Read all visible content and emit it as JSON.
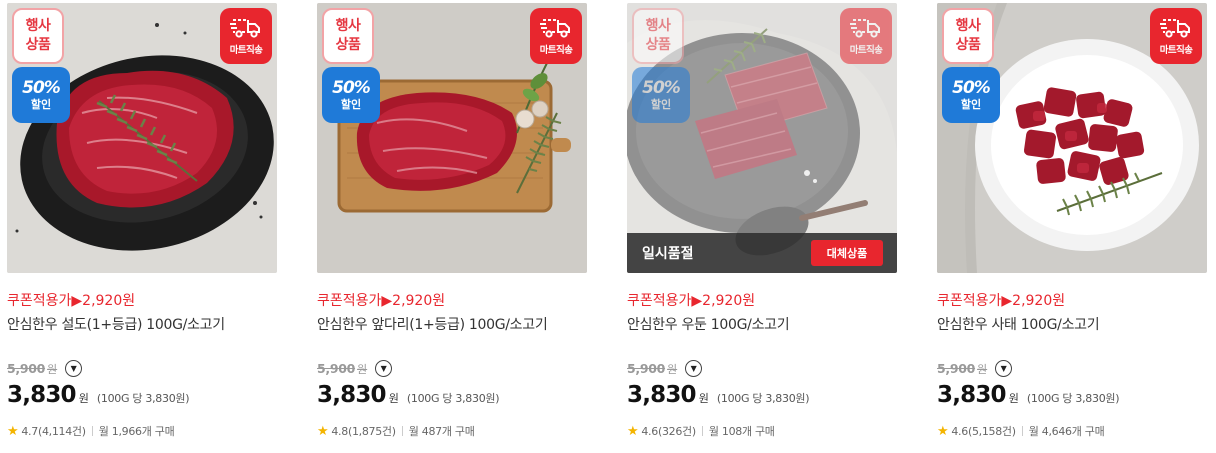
{
  "badges": {
    "event_line1": "행사",
    "event_line2": "상품",
    "mart_delivery": "마트직송",
    "sale_percent": "50%",
    "sale_label": "할인"
  },
  "soldout": {
    "text": "일시품절",
    "button": "대체상품"
  },
  "colors": {
    "accent_red": "#e8262e",
    "sale_blue": "#1f7ad8",
    "star": "#f4b400"
  },
  "products": [
    {
      "coupon": "쿠폰적용가▶2,920원",
      "title": "안심한우 설도(1+등급) 100G/소고기",
      "original_price": "5,900",
      "original_won": "원",
      "price": "3,830",
      "won": "원",
      "unit_price": "(100G 당 3,830원)",
      "rating": "4.7(4,114건)",
      "monthly": "월 1,966개 구매",
      "soldout": false
    },
    {
      "coupon": "쿠폰적용가▶2,920원",
      "title": "안심한우 앞다리(1+등급) 100G/소고기",
      "original_price": "5,900",
      "original_won": "원",
      "price": "3,830",
      "won": "원",
      "unit_price": "(100G 당 3,830원)",
      "rating": "4.8(1,875건)",
      "monthly": "월 487개 구매",
      "soldout": false
    },
    {
      "coupon": "쿠폰적용가▶2,920원",
      "title": "안심한우 우둔 100G/소고기",
      "original_price": "5,900",
      "original_won": "원",
      "price": "3,830",
      "won": "원",
      "unit_price": "(100G 당 3,830원)",
      "rating": "4.6(326건)",
      "monthly": "월 108개 구매",
      "soldout": true
    },
    {
      "coupon": "쿠폰적용가▶2,920원",
      "title": "안심한우 사태 100G/소고기",
      "original_price": "5,900",
      "original_won": "원",
      "price": "3,830",
      "won": "원",
      "unit_price": "(100G 당 3,830원)",
      "rating": "4.6(5,158건)",
      "monthly": "월 4,646개 구매",
      "soldout": false
    }
  ]
}
